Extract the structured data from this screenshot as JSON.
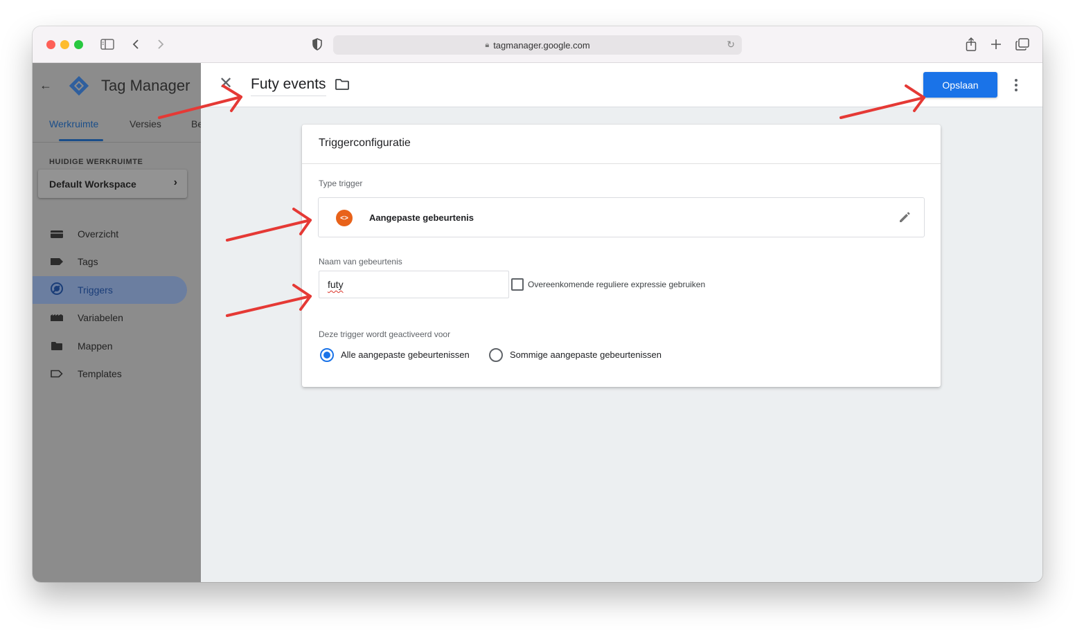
{
  "browser": {
    "url": "tagmanager.google.com"
  },
  "sidebar": {
    "app_title": "Tag Manager",
    "tabs": [
      {
        "label": "Werkruimte",
        "active": true
      },
      {
        "label": "Versies",
        "active": false
      },
      {
        "label": "Be",
        "active": false
      }
    ],
    "workspace_section_label": "HUIDIGE WERKRUIMTE",
    "workspace_name": "Default Workspace",
    "nav": [
      {
        "label": "Overzicht",
        "icon": "briefcase-icon",
        "active": false
      },
      {
        "label": "Tags",
        "icon": "tag-icon",
        "active": false
      },
      {
        "label": "Triggers",
        "icon": "trigger-icon",
        "active": true
      },
      {
        "label": "Variabelen",
        "icon": "variable-icon",
        "active": false
      },
      {
        "label": "Mappen",
        "icon": "folder-icon",
        "active": false
      },
      {
        "label": "Templates",
        "icon": "template-icon",
        "active": false
      }
    ]
  },
  "editor": {
    "title": "Futy events",
    "save_label": "Opslaan"
  },
  "trigger_config": {
    "card_title": "Triggerconfiguratie",
    "type_label": "Type trigger",
    "type_name": "Aangepaste gebeurtenis",
    "event_name_label": "Naam van gebeurtenis",
    "event_name_value": "futy",
    "regex_checkbox_label": "Overeenkomende reguliere expressie gebruiken",
    "regex_checked": false,
    "fires_on_label": "Deze trigger wordt geactiveerd voor",
    "fires_on_options": [
      {
        "label": "Alle aangepaste gebeurtenissen",
        "selected": true
      },
      {
        "label": "Sommige aangepaste gebeurtenissen",
        "selected": false
      }
    ]
  },
  "colors": {
    "accent": "#1a73e8",
    "trigger_type_icon": "#e8621a",
    "annotation_arrows": "#e53935"
  }
}
